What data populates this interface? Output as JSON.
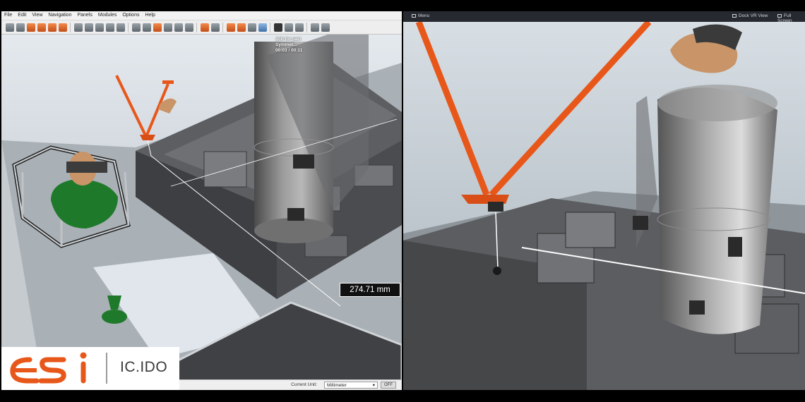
{
  "left_window": {
    "menu": [
      "File",
      "Edit",
      "View",
      "Navigation",
      "Panels",
      "Modules",
      "Options",
      "Help"
    ],
    "job_text": [
      "Job for part",
      "Symmet...",
      "00:03 / 00:11"
    ],
    "measurement": "274.71 mm",
    "status": {
      "label": "Current Unit:",
      "unit": "Millimeter",
      "off_label": "OFF"
    }
  },
  "right_window": {
    "menu_label": "Menu",
    "dock_label": "Dock VR View",
    "fullscreen_label": "Full Screen"
  },
  "logo": {
    "brand_text": "esi",
    "product_text": "IC.IDO"
  },
  "colors": {
    "accent_orange": "#e8571a",
    "model_green": "#1e7a2a",
    "background": "#000000"
  }
}
